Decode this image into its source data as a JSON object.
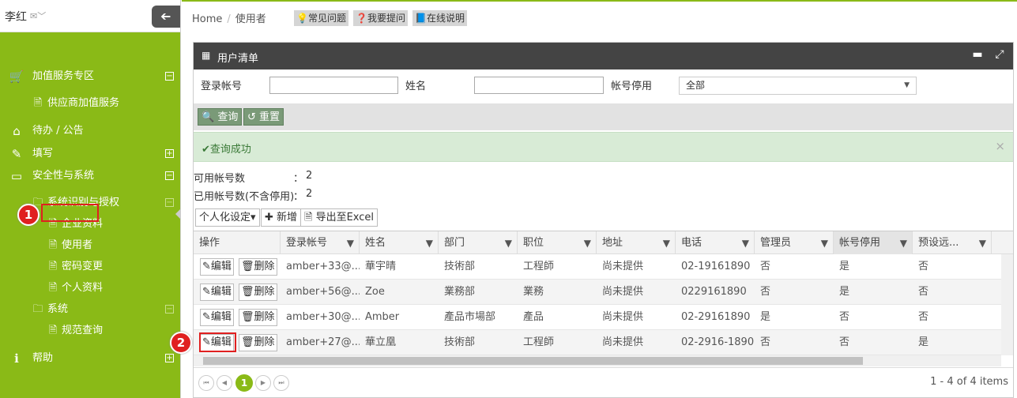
{
  "sidebar": {
    "user_name": "李红",
    "user_menu_glyph": "✉﹀",
    "collapse_glyph": "➔",
    "items": [
      {
        "label": "加值服务专区",
        "icon": "cart-icon",
        "glyph": "🛒",
        "toggle": "⊟"
      },
      {
        "label": "供应商加值服务",
        "icon": "doc-icon",
        "glyph": "🗎"
      },
      {
        "label": "待办 / 公告",
        "icon": "home-icon",
        "glyph": "⌂"
      },
      {
        "label": "填写",
        "icon": "edit-icon",
        "glyph": "✎",
        "toggle": "⊞"
      },
      {
        "label": "安全性与系统",
        "icon": "monitor-icon",
        "glyph": "▭",
        "toggle": "⊟"
      },
      {
        "label": "系统识别与授权",
        "icon": "folder-icon",
        "glyph": "🗀",
        "toggle": "⊟"
      },
      {
        "label": "企业资料",
        "icon": "doc-icon",
        "glyph": "🗎"
      },
      {
        "label": "使用者",
        "icon": "doc-icon",
        "glyph": "🗎"
      },
      {
        "label": "密码变更",
        "icon": "doc-icon",
        "glyph": "🗎"
      },
      {
        "label": "个人资料",
        "icon": "doc-icon",
        "glyph": "🗎"
      },
      {
        "label": "系统",
        "icon": "folder-icon",
        "glyph": "🗀",
        "toggle": "⊟"
      },
      {
        "label": "规范查询",
        "icon": "doc-icon",
        "glyph": "🗎"
      },
      {
        "label": "帮助",
        "icon": "info-icon",
        "glyph": "ℹ",
        "toggle": "⊞"
      }
    ]
  },
  "annotations": {
    "badge1": "1",
    "badge2": "2"
  },
  "breadcrumb": {
    "home": "Home",
    "sep": "/",
    "current": "使用者"
  },
  "toolbar": {
    "faq": "💡常见问题",
    "ask": "❓我要提问",
    "manual": "📘在线说明"
  },
  "panel": {
    "grid_glyph": "▦",
    "title": "用户清单",
    "minimize_glyph": "▬",
    "expand_glyph": "⤢"
  },
  "filters": {
    "account_label": "登录帐号",
    "name_label": "姓名",
    "disabled_label": "帐号停用",
    "disabled_value": "全部",
    "caret": "▼"
  },
  "actions": {
    "query": "🔍 查询",
    "reset": "↺ 重置"
  },
  "alert": {
    "message": "✔查询成功",
    "close": "×"
  },
  "stats": {
    "available_label": "可用帐号数",
    "available_sep": "：",
    "available_value": "2",
    "used_label": "已用帐号数(不含停用)",
    "used_sep": "：",
    "used_value": "2"
  },
  "grid_tools": {
    "personalize": "个人化设定▾",
    "add": "✚ 新增",
    "export": "🗎 导出至Excel"
  },
  "table": {
    "filter_glyph": "▼",
    "columns": [
      "操作",
      "登录帐号",
      "姓名",
      "部门",
      "职位",
      "地址",
      "电话",
      "管理员",
      "帐号停用",
      "预设远..."
    ],
    "edit_label": "✎编辑",
    "delete_label": "🗑删除",
    "rows": [
      {
        "account": "amber+33@...",
        "name": "華宇晴",
        "dept": "技術部",
        "title": "工程師",
        "address": "尚未提供",
        "phone": "02-19161890",
        "admin": "否",
        "disabled": "是",
        "remote": "否"
      },
      {
        "account": "amber+56@...",
        "name": "Zoe",
        "dept": "業務部",
        "title": "業務",
        "address": "尚未提供",
        "phone": "0229161890",
        "admin": "否",
        "disabled": "是",
        "remote": "否"
      },
      {
        "account": "amber+30@...",
        "name": "Amber",
        "dept": "產品市場部",
        "title": "產品",
        "address": "尚未提供",
        "phone": "02-29161890",
        "admin": "是",
        "disabled": "否",
        "remote": "否"
      },
      {
        "account": "amber+27@...",
        "name": "華立凰",
        "dept": "技術部",
        "title": "工程師",
        "address": "尚未提供",
        "phone": "02-2916-1890",
        "admin": "否",
        "disabled": "否",
        "remote": "是"
      }
    ]
  },
  "pager": {
    "first": "⏮",
    "prev": "◀",
    "page": "1",
    "next": "▶",
    "last": "⏭",
    "info": "1 - 4 of 4 items"
  },
  "colors": {
    "accent": "#8aba17",
    "marker": "#e02020",
    "success_bg": "#d8ebd6"
  }
}
